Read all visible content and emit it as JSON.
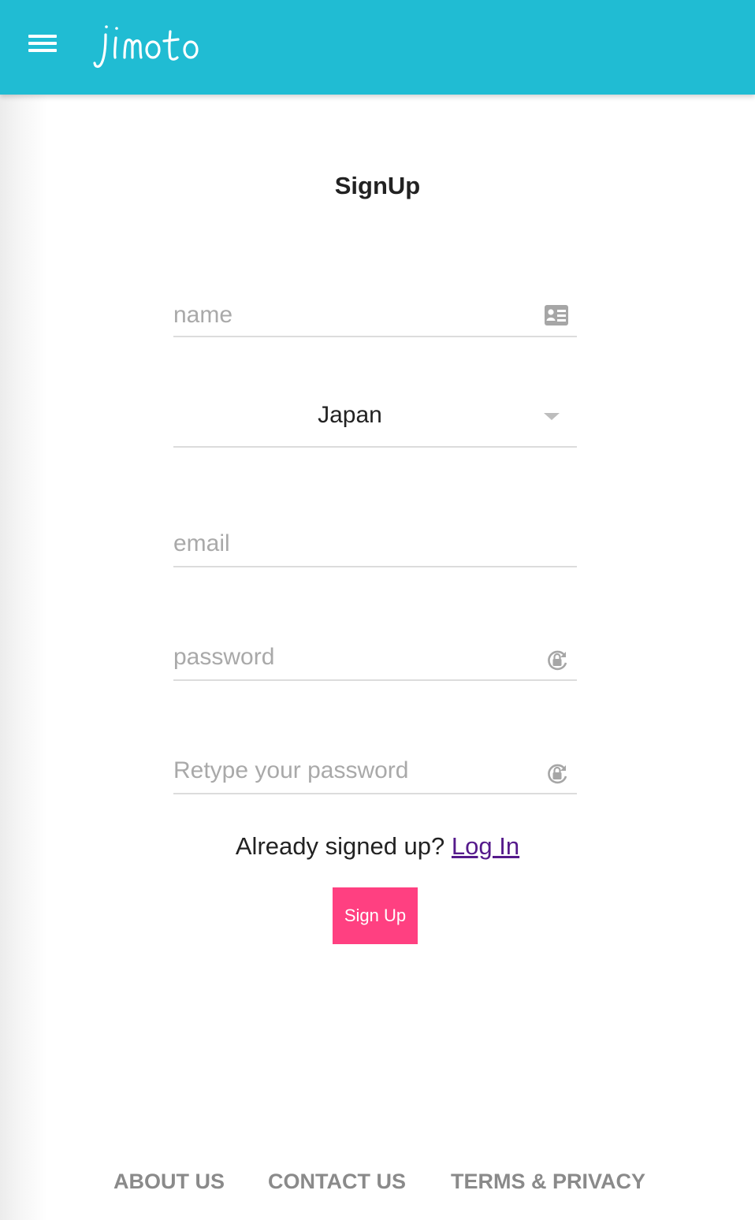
{
  "header": {
    "brand": "jimoto",
    "background_color": "#20bcd3",
    "menu_icon": "hamburger-menu-icon"
  },
  "form": {
    "title": "SignUp",
    "name_placeholder": "name",
    "country_selected": "Japan",
    "email_placeholder": "email",
    "password_placeholder": "password",
    "retype_placeholder": "Retype your password",
    "icons": {
      "name": "id-card-icon",
      "password": "lock-reset-icon",
      "retype": "lock-reset-icon"
    },
    "already_text": "Already signed up?",
    "login_link": "Log In",
    "submit_label": "Sign Up",
    "submit_color": "#ff4081"
  },
  "footer": {
    "links": [
      "ABOUT US",
      "CONTACT US",
      "TERMS & PRIVACY"
    ]
  }
}
